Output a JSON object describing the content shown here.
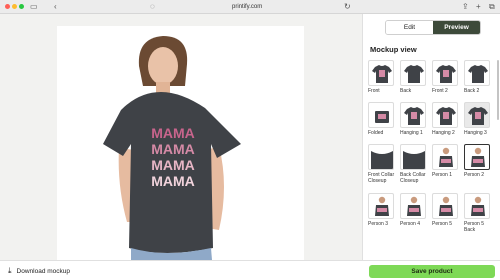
{
  "browser": {
    "url": "printify.com",
    "icons": [
      "sidebar-icon",
      "back-icon",
      "shield-icon",
      "reload-icon",
      "share-icon",
      "new-tab-icon",
      "tabs-icon"
    ]
  },
  "mockup": {
    "design_text": [
      "MAMA",
      "MAMA",
      "MAMA",
      "MAMA"
    ],
    "shirt_color": "#3f4247",
    "print_colors": [
      "#c8648c",
      "#d58aa6",
      "#e8b6c6",
      "#f1d3dc"
    ]
  },
  "panel": {
    "edit_label": "Edit",
    "preview_label": "Preview",
    "title": "Mockup view",
    "views": [
      {
        "label": "Front"
      },
      {
        "label": "Back"
      },
      {
        "label": "Front 2"
      },
      {
        "label": "Back 2"
      },
      {
        "label": "Folded"
      },
      {
        "label": "Hanging 1"
      },
      {
        "label": "Hanging 2"
      },
      {
        "label": "Hanging 3"
      },
      {
        "label": "Front Collar Closeup"
      },
      {
        "label": "Back Collar Closeup"
      },
      {
        "label": "Person 1"
      },
      {
        "label": "Person 2"
      },
      {
        "label": "Person 3"
      },
      {
        "label": "Person 4"
      },
      {
        "label": "Person 5"
      },
      {
        "label": "Person 5 Back"
      }
    ],
    "selected_view": "Person 2"
  },
  "bottom": {
    "download_label": "Download mockup",
    "save_label": "Save product"
  }
}
